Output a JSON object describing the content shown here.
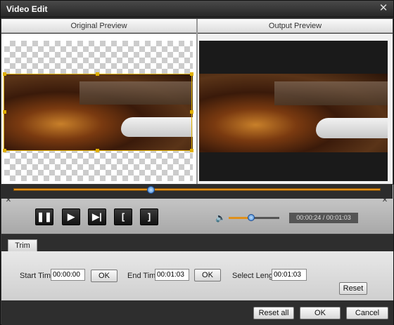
{
  "window": {
    "title": "Video Edit",
    "close_icon": "close-icon"
  },
  "preview": {
    "original_label": "Original Preview",
    "output_label": "Output Preview"
  },
  "playback": {
    "pause_label": "❚❚",
    "play_label": "▶",
    "next_frame_label": "▶|",
    "mark_in_label": "[",
    "mark_out_label": "]",
    "time_display": "00:00:24 / 00:01:03",
    "progress": 0.375,
    "volume": 0.45
  },
  "tabs": [
    {
      "label": "Trim"
    }
  ],
  "trim": {
    "start_label": "Start Time",
    "start_value": "00:00:00",
    "start_ok": "OK",
    "end_label": "End Time",
    "end_value": "00:01:03",
    "end_ok": "OK",
    "length_label": "Select Length",
    "length_value": "00:01:03",
    "reset_label": "Reset"
  },
  "footer": {
    "reset_all_label": "Reset all",
    "ok_label": "OK",
    "cancel_label": "Cancel"
  },
  "colors": {
    "accent": "#e0901a",
    "crop_frame": "#e0b000"
  }
}
